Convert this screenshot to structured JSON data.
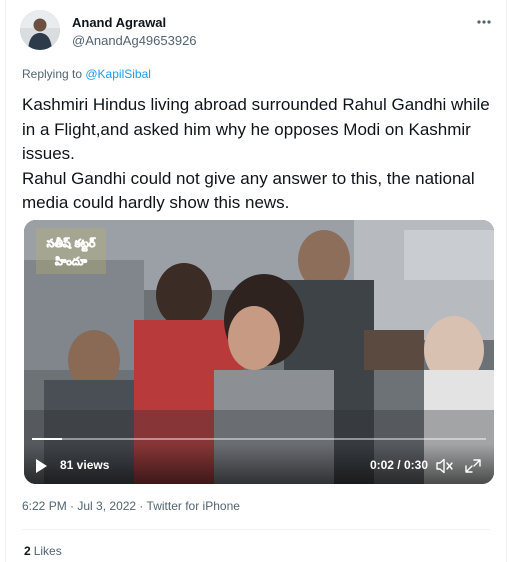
{
  "author": {
    "name": "Anand Agrawal",
    "handle": "@AnandAg49653926"
  },
  "more_icon": "more-horizontal-icon",
  "reply_context": {
    "prefix": "Replying to ",
    "mention": "@KapilSibal"
  },
  "tweet_text": "Kashmiri Hindus living abroad surrounded Rahul Gandhi while in a Flight,and asked him why he opposes Modi on Kashmir issues.\nRahul Gandhi could not give any answer to this, the national media could hardly show this news.",
  "video": {
    "watermark_text": "సతీష్ కట్టర్ హిందూ",
    "views": "81 views",
    "time": "0:02 / 0:30",
    "progress_fraction": 0.0667,
    "icons": [
      "play-icon",
      "mute-icon",
      "fullscreen-icon"
    ]
  },
  "meta": {
    "time": "6:22 PM",
    "sep1": " · ",
    "date": "Jul 3, 2022",
    "sep2": " · ",
    "source": "Twitter for iPhone"
  },
  "engagement": {
    "likes_count": "2",
    "likes_label": "Likes"
  },
  "colors": {
    "link": "#1d9bf0",
    "secondary_text": "#536471",
    "primary_text": "#0f1419"
  }
}
